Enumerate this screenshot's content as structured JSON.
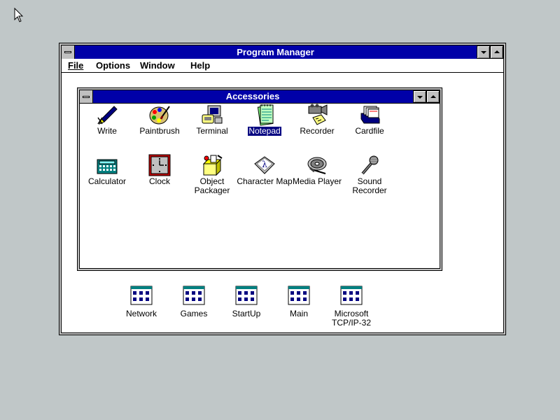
{
  "program_manager": {
    "title": "Program Manager",
    "menu": [
      {
        "label": "File"
      },
      {
        "label": "Options"
      },
      {
        "label": "Window"
      },
      {
        "label": "Help"
      }
    ]
  },
  "accessories": {
    "title": "Accessories",
    "icons": [
      {
        "label": "Write",
        "icon": "write-icon"
      },
      {
        "label": "Paintbrush",
        "icon": "paintbrush-icon"
      },
      {
        "label": "Terminal",
        "icon": "terminal-icon"
      },
      {
        "label": "Notepad",
        "icon": "notepad-icon",
        "selected": true
      },
      {
        "label": "Recorder",
        "icon": "recorder-icon"
      },
      {
        "label": "Cardfile",
        "icon": "cardfile-icon"
      },
      {
        "label": "Calculator",
        "icon": "calculator-icon"
      },
      {
        "label": "Clock",
        "icon": "clock-icon"
      },
      {
        "label": "Object Packager",
        "icon": "object-packager-icon"
      },
      {
        "label": "Character Map",
        "icon": "character-map-icon"
      },
      {
        "label": "Media Player",
        "icon": "media-player-icon"
      },
      {
        "label": "Sound Recorder",
        "icon": "sound-recorder-icon"
      }
    ]
  },
  "groups": [
    {
      "label": "Network"
    },
    {
      "label": "Games"
    },
    {
      "label": "StartUp"
    },
    {
      "label": "Main"
    },
    {
      "label": "Microsoft TCP/IP-32"
    }
  ],
  "colors": {
    "desktop": "#c0c7c8",
    "titlebar": "#0000a8",
    "selection": "#000080"
  }
}
